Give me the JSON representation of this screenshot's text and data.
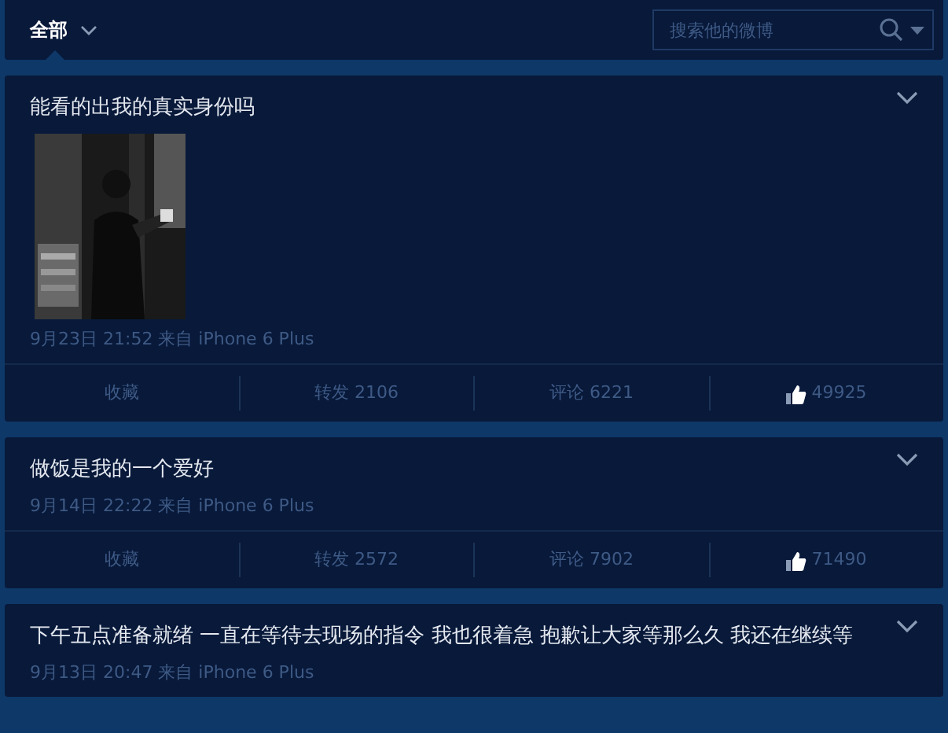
{
  "filter": {
    "label": "全部"
  },
  "search": {
    "placeholder": "搜索他的微博"
  },
  "posts": [
    {
      "text": "能看的出我的真实身份吗",
      "meta": "9月23日 21:52 来自 iPhone 6 Plus",
      "actions": {
        "favorite": "收藏",
        "repost": "转发 2106",
        "comment": "评论 6221",
        "likes": "49925"
      }
    },
    {
      "text": "做饭是我的一个爱好",
      "meta": "9月14日 22:22 来自 iPhone 6 Plus",
      "actions": {
        "favorite": "收藏",
        "repost": "转发 2572",
        "comment": "评论 7902",
        "likes": "71490"
      }
    },
    {
      "text": "下午五点准备就绪 一直在等待去现场的指令 我也很着急 抱歉让大家等那么久 我还在继续等",
      "meta": "9月13日 20:47 来自 iPhone 6 Plus"
    }
  ]
}
